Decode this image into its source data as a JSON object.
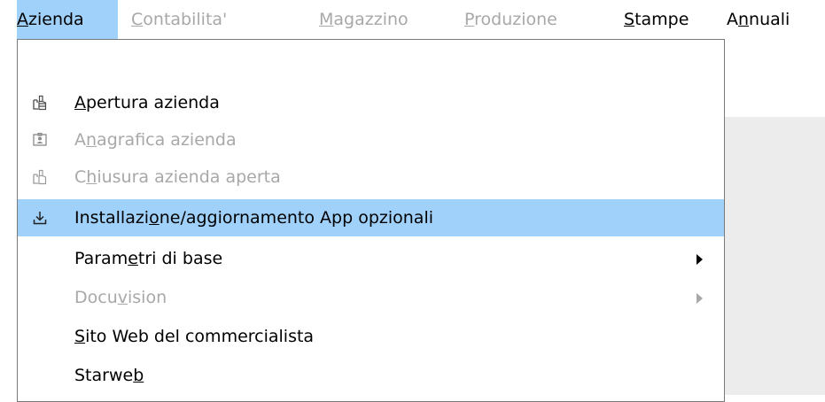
{
  "menubar": {
    "items": [
      {
        "label_parts": [
          "",
          "A",
          "zienda"
        ],
        "state": "active"
      },
      {
        "label_parts": [
          "",
          "C",
          "ontabilita'"
        ],
        "state": "disabled"
      },
      {
        "label_parts": [
          "",
          "M",
          "agazzino"
        ],
        "state": "disabled"
      },
      {
        "label_parts": [
          "",
          "P",
          "roduzione"
        ],
        "state": "disabled"
      },
      {
        "label_parts": [
          "",
          "S",
          "tampe"
        ],
        "state": "enabled"
      },
      {
        "label_parts": [
          "A",
          "n",
          "nuali"
        ],
        "state": "enabled"
      }
    ]
  },
  "dropdown": {
    "items": [
      {
        "label_parts": [
          "",
          "A",
          "pertura azienda"
        ],
        "icon": "open-company-icon",
        "state": "enabled"
      },
      {
        "label_parts": [
          "A",
          "n",
          "agrafica azienda"
        ],
        "icon": "company-registry-icon",
        "state": "disabled"
      },
      {
        "label_parts": [
          "C",
          "h",
          "iusura azienda aperta"
        ],
        "icon": "close-company-icon",
        "state": "disabled"
      },
      {
        "label_parts": [
          "Installazi",
          "o",
          "ne/aggiornamento App opzionali"
        ],
        "icon": "download-icon",
        "state": "highlighted"
      },
      {
        "label_parts": [
          "Param",
          "e",
          "tri di base"
        ],
        "icon": "",
        "state": "enabled",
        "submenu": true
      },
      {
        "label_parts": [
          "Docu",
          "v",
          "ision"
        ],
        "icon": "",
        "state": "disabled",
        "submenu": true
      },
      {
        "label_parts": [
          "",
          "S",
          "ito Web del commercialista"
        ],
        "icon": "",
        "state": "enabled"
      },
      {
        "label_parts": [
          "Starwe",
          "b",
          ""
        ],
        "icon": "",
        "state": "enabled"
      }
    ]
  },
  "colors": {
    "highlight": "#9fd1fb",
    "disabled_text": "#a8a8a8",
    "border": "#7a7a7a",
    "background_panel": "#ececec"
  }
}
